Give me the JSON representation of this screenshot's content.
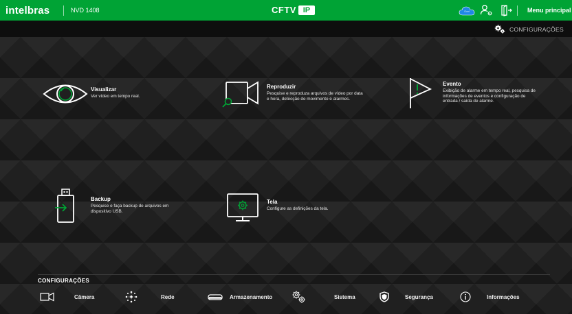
{
  "topbar": {
    "logo": "intelbras",
    "model": "NVD 1408",
    "brand_text": "CFTV",
    "brand_badge": "IP",
    "cloud_label": "Intelbras Cloud",
    "main_menu": "Menu principal",
    "accent": "#00a335"
  },
  "subbar": {
    "config_label": "CONFIGURAÇÕES"
  },
  "tiles": {
    "visualizar": {
      "title": "Visualizar",
      "desc": "Ver vídeo em tempo real."
    },
    "reproduzir": {
      "title": "Reproduzir",
      "desc1": "Pesquise e reproduza arquivos de vídeo por data",
      "desc2": "e hora, detecção de movimento e alarmes."
    },
    "evento": {
      "title": "Evento",
      "desc1": "Exibição de alarme em tempo real, pesquisa de",
      "desc2": "informações de eventos e configuração de",
      "desc3": "entrada / saída de alarme."
    },
    "backup": {
      "title": "Backup",
      "desc1": "Pesquise e faça backup de arquivos em",
      "desc2": "dispositivo USB."
    },
    "tela": {
      "title": "Tela",
      "desc": "Configure as definições da tela."
    }
  },
  "config": {
    "title": "CONFIGURAÇÕES",
    "items": [
      {
        "label": "Câmera",
        "icon": "camera-icon"
      },
      {
        "label": "Rede",
        "icon": "network-icon"
      },
      {
        "label": "Armazenamento",
        "icon": "storage-icon"
      },
      {
        "label": "Sistema",
        "icon": "gears-icon"
      },
      {
        "label": "Segurança",
        "icon": "shield-icon"
      },
      {
        "label": "Informações",
        "icon": "info-icon"
      }
    ]
  }
}
